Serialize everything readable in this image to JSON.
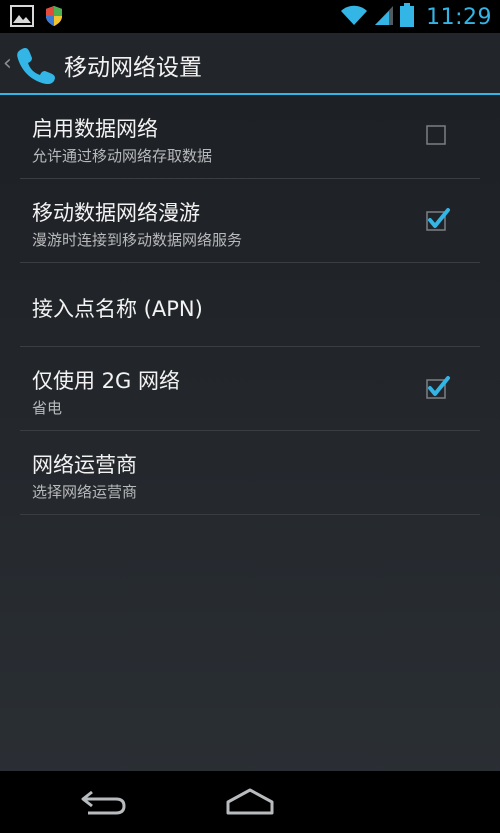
{
  "status_bar": {
    "time": "11:29",
    "icons": [
      "gallery-icon",
      "shield-icon",
      "wifi-icon",
      "signal-icon",
      "battery-icon"
    ],
    "accent": "#33b5e5"
  },
  "action_bar": {
    "title": "移动网络设置",
    "app_icon": "phone-icon"
  },
  "settings": [
    {
      "primary": "启用数据网络",
      "secondary": "允许通过移动网络存取数据",
      "checked": false
    },
    {
      "primary": "移动数据网络漫游",
      "secondary": "漫游时连接到移动数据网络服务",
      "checked": true
    },
    {
      "primary": "接入点名称 (APN)"
    },
    {
      "primary": "仅使用 2G 网络",
      "secondary": "省电",
      "checked": true
    },
    {
      "primary": "网络运营商",
      "secondary": "选择网络运营商"
    }
  ],
  "nav_bar": {
    "buttons": [
      "back-icon",
      "home-icon"
    ]
  }
}
